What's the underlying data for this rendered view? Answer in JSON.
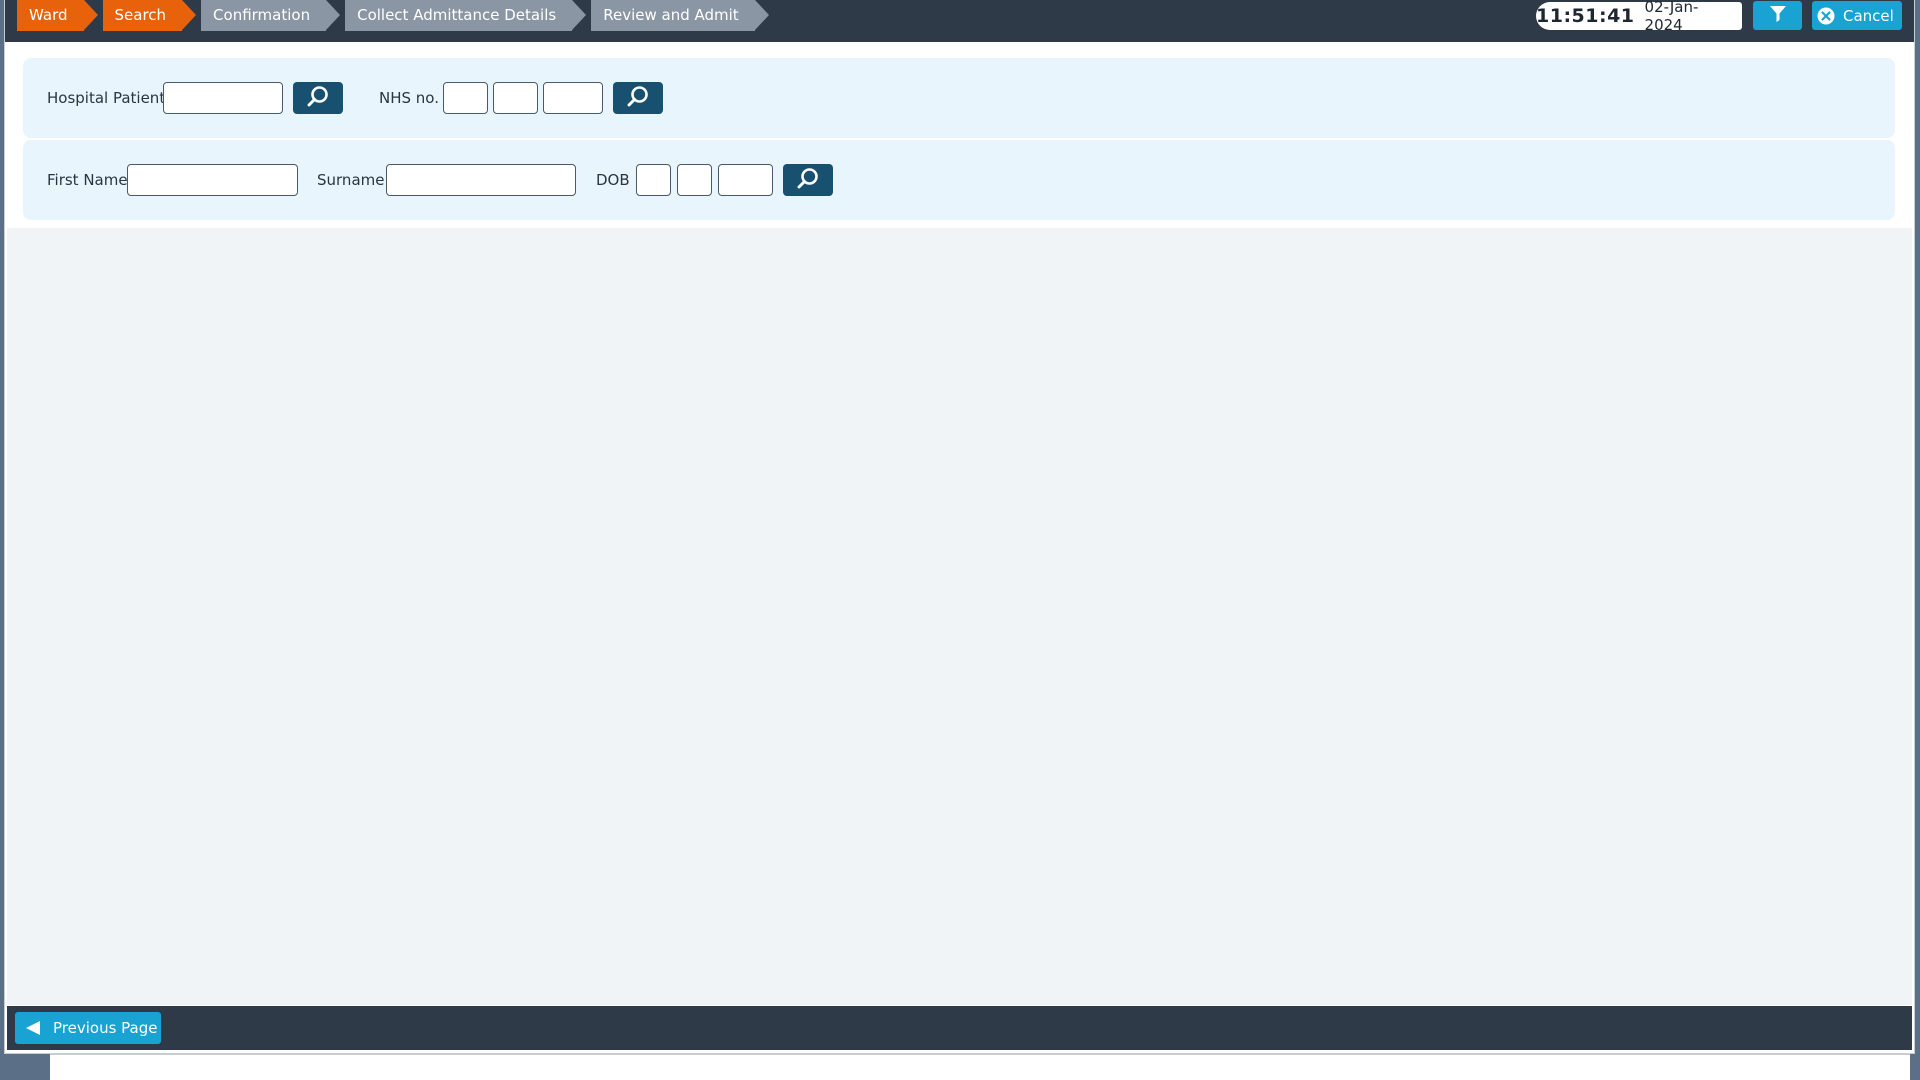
{
  "breadcrumbs": [
    {
      "label": "Ward",
      "state": "active"
    },
    {
      "label": "Search",
      "state": "active"
    },
    {
      "label": "Confirmation",
      "state": "inactive"
    },
    {
      "label": "Collect Admittance Details",
      "state": "inactive"
    },
    {
      "label": "Review and Admit",
      "state": "inactive"
    }
  ],
  "clock": {
    "time": "11:51:41",
    "date": "02-Jan-2024"
  },
  "toolbar": {
    "filter_icon": "filter-icon",
    "cancel_label": "Cancel",
    "cancel_icon": "close-circle-icon"
  },
  "search": {
    "hospital_id_label": "Hospital Patient ID",
    "hospital_id_value": "",
    "nhs_label": "NHS no.",
    "nhs_part1": "",
    "nhs_part2": "",
    "nhs_part3": "",
    "first_name_label": "First Name",
    "first_name_value": "",
    "surname_label": "Surname",
    "surname_value": "",
    "dob_label": "DOB",
    "dob_day": "",
    "dob_month": "",
    "dob_year": "",
    "search_icon": "search-icon"
  },
  "footer": {
    "previous_label": "Previous Page",
    "previous_icon": "left-arrow-icon"
  },
  "colors": {
    "topbar_bg": "#2e3a48",
    "crumb_active": "#e8620c",
    "crumb_inactive": "#8a96a3",
    "accent_button": "#18a3d3",
    "search_button": "#18506f",
    "panel_bg": "#e9f5fc"
  }
}
